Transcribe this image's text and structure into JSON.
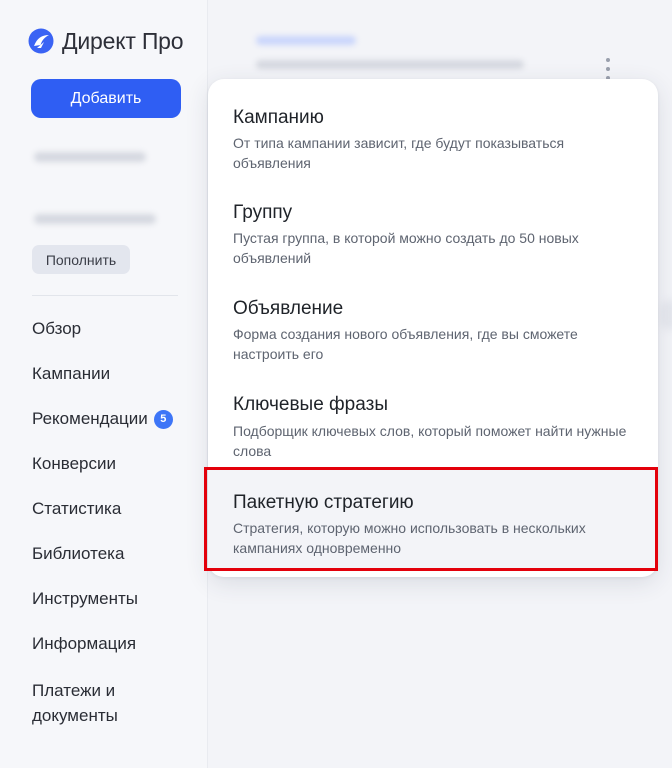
{
  "brand": {
    "name": "Директ Про",
    "logo_icon": "direct-logo-icon",
    "logo_color": "#3a63f4"
  },
  "sidebar": {
    "add_label": "Добавить",
    "topup_label": "Пополнить",
    "nav": [
      {
        "label": "Обзор"
      },
      {
        "label": "Кампании"
      },
      {
        "label": "Рекомендации",
        "badge": "5"
      },
      {
        "label": "Конверсии"
      },
      {
        "label": "Статистика"
      },
      {
        "label": "Библиотека"
      },
      {
        "label": "Инструменты"
      },
      {
        "label": "Информация"
      },
      {
        "label": "Платежи и документы"
      }
    ]
  },
  "menu": {
    "items": [
      {
        "title": "Кампанию",
        "desc": "От типа кампании зависит, где будут показываться объявления"
      },
      {
        "title": "Группу",
        "desc": "Пустая группа, в которой можно создать до 50 новых объявлений"
      },
      {
        "title": "Объявление",
        "desc": "Форма создания нового объявления, где вы сможете настроить его"
      },
      {
        "title": "Ключевые фразы",
        "desc": "Подборщик ключевых слов, который поможет найти нужные слова"
      },
      {
        "title": "Пакетную стратегию",
        "desc": "Стратегия, которую можно использовать в нескольких кампаниях одновременно"
      }
    ]
  },
  "colors": {
    "accent": "#2f5ef3",
    "badge": "#3d75f7",
    "highlight": "#e3000b"
  }
}
